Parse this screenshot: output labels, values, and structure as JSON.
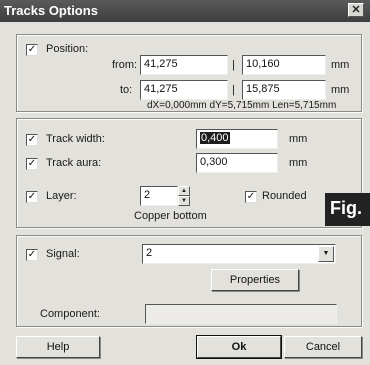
{
  "window": {
    "title": "Tracks Options",
    "close_glyph": "✕"
  },
  "position": {
    "checked": true,
    "label": "Position:",
    "from_label": "from:",
    "to_label": "to:",
    "from_x": "41,275",
    "from_y": "10,160",
    "to_x": "41,275",
    "to_y": "15,875",
    "separator": "|",
    "unit": "mm",
    "info": "dX=0,000mm dY=5,715mm Len=5,715mm"
  },
  "track": {
    "width_checked": true,
    "width_label": "Track width:",
    "width_value": "0,400",
    "aura_checked": true,
    "aura_label": "Track aura:",
    "aura_value": "0,300",
    "unit": "mm",
    "layer_checked": true,
    "layer_label": "Layer:",
    "layer_value": "2",
    "layer_name": "Copper bottom",
    "rounded_checked": true,
    "rounded_label": "Rounded"
  },
  "signal": {
    "checked": true,
    "label": "Signal:",
    "value": "2",
    "properties_button": "Properties",
    "component_label": "Component:",
    "component_value": ""
  },
  "buttons": {
    "help": "Help",
    "ok": "Ok",
    "cancel": "Cancel"
  },
  "badge": {
    "text": "Fig."
  },
  "icons": {
    "check": "✓",
    "spin_up": "▲",
    "spin_down": "▼",
    "dropdown": "▼"
  }
}
